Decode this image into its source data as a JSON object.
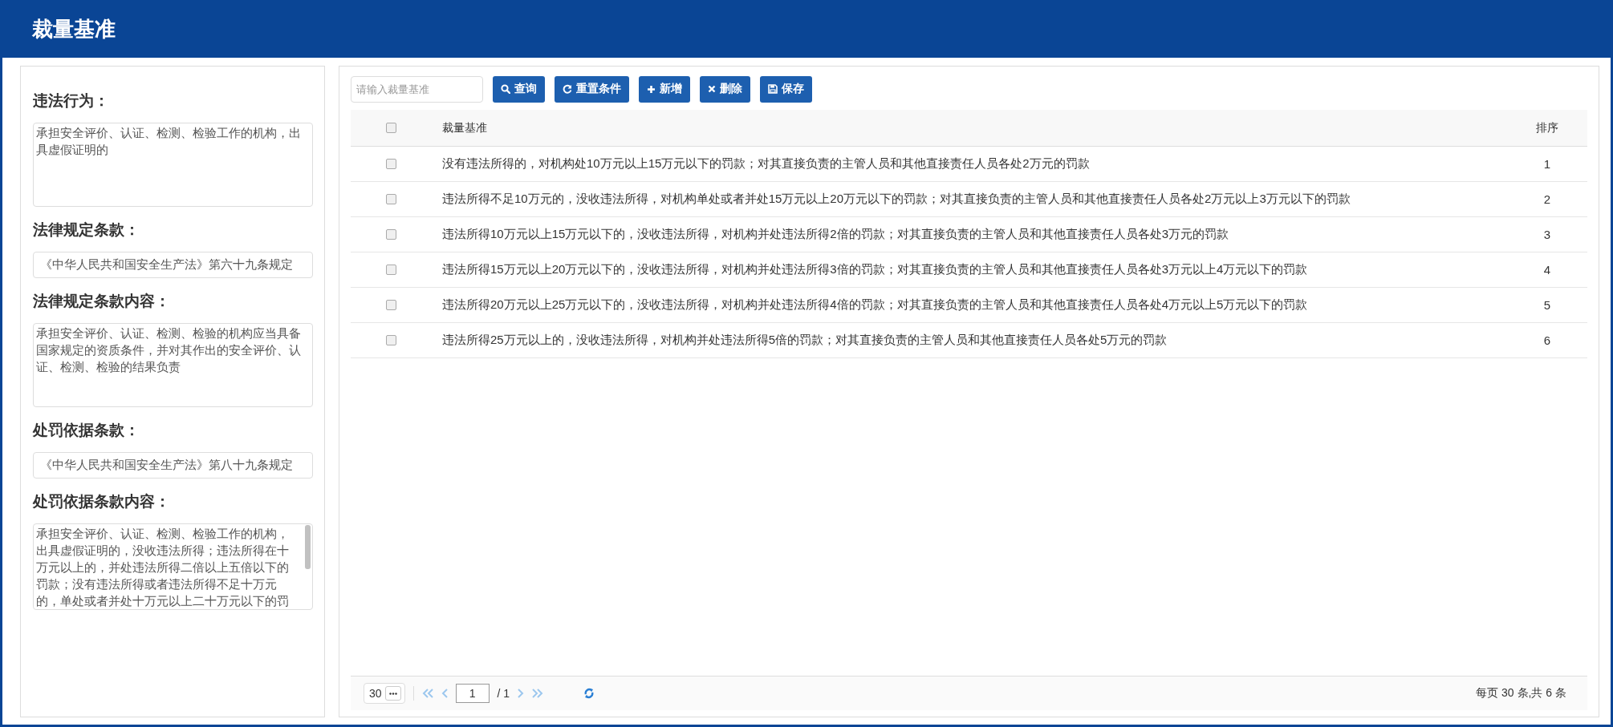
{
  "header": {
    "title": "裁量基准"
  },
  "form": [
    {
      "label": "违法行为：",
      "kind": "textarea",
      "value": "承担安全评价、认证、检测、检验工作的机构，出具虚假证明的"
    },
    {
      "label": "法律规定条款：",
      "kind": "input",
      "value": "《中华人民共和国安全生产法》第六十九条规定"
    },
    {
      "label": "法律规定条款内容：",
      "kind": "textarea",
      "value": "承担安全评价、认证、检测、检验的机构应当具备国家规定的资质条件，并对其作出的安全评价、认证、检测、检验的结果负责"
    },
    {
      "label": "处罚依据条款：",
      "kind": "input",
      "value": "《中华人民共和国安全生产法》第八十九条规定"
    },
    {
      "label": "处罚依据条款内容：",
      "kind": "scrolltext",
      "value": "承担安全评价、认证、检测、检验工作的机构，出具虚假证明的，没收违法所得；违法所得在十万元以上的，并处违法所得二倍以上五倍以下的罚款；没有违法所得或者违法所得不足十万元的，单处或者并处十万元以上二十万元以下的罚"
    }
  ],
  "toolbar": {
    "search_placeholder": "请输入裁量基准",
    "buttons": [
      {
        "label": "查询",
        "kind": "search"
      },
      {
        "label": "重置条件",
        "kind": "reset"
      },
      {
        "label": "新增",
        "kind": "add"
      },
      {
        "label": "删除",
        "kind": "delete"
      },
      {
        "label": "保存",
        "kind": "save"
      }
    ]
  },
  "table": {
    "select_all_checked": false,
    "columns": [
      "裁量基准",
      "排序"
    ],
    "rows": [
      {
        "checked": false,
        "text": "没有违法所得的，对机构处10万元以上15万元以下的罚款；对其直接负责的主管人员和其他直接责任人员各处2万元的罚款",
        "order": "1"
      },
      {
        "checked": false,
        "text": "违法所得不足10万元的，没收违法所得，对机构单处或者并处15万元以上20万元以下的罚款；对其直接负责的主管人员和其他直接责任人员各处2万元以上3万元以下的罚款",
        "order": "2"
      },
      {
        "checked": false,
        "text": "违法所得10万元以上15万元以下的，没收违法所得，对机构并处违法所得2倍的罚款；对其直接负责的主管人员和其他直接责任人员各处3万元的罚款",
        "order": "3"
      },
      {
        "checked": false,
        "text": "违法所得15万元以上20万元以下的，没收违法所得，对机构并处违法所得3倍的罚款；对其直接负责的主管人员和其他直接责任人员各处3万元以上4万元以下的罚款",
        "order": "4"
      },
      {
        "checked": false,
        "text": "违法所得20万元以上25万元以下的，没收违法所得，对机构并处违法所得4倍的罚款；对其直接负责的主管人员和其他直接责任人员各处4万元以上5万元以下的罚款",
        "order": "5"
      },
      {
        "checked": false,
        "text": "违法所得25万元以上的，没收违法所得，对机构并处违法所得5倍的罚款；对其直接负责的主管人员和其他直接责任人员各处5万元的罚款",
        "order": "6"
      }
    ]
  },
  "pagination": {
    "page_size": "30",
    "page": "1",
    "total_pages": "/ 1",
    "summary": "每页 30 条,共 6 条",
    "nav_disabled": true
  }
}
